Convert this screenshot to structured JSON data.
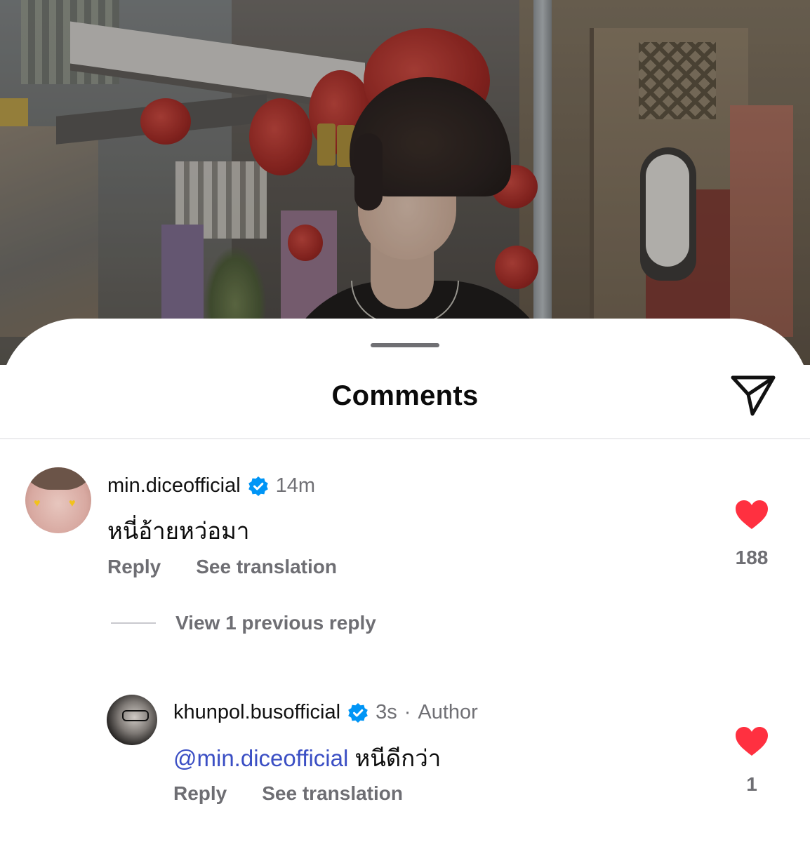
{
  "sheet": {
    "title": "Comments"
  },
  "comments": [
    {
      "username": "min.diceofficial",
      "time": "14m",
      "text": "หนี่อ้ายหว่อมา",
      "reply_label": "Reply",
      "translate_label": "See translation",
      "likes": "188"
    }
  ],
  "view_replies": "View 1 previous reply",
  "replies": [
    {
      "username": "khunpol.busofficial",
      "time": "3s",
      "author_sep": "·",
      "author_badge": "Author",
      "mention": "@min.diceofficial",
      "text": "หนีดีกว่า",
      "reply_label": "Reply",
      "translate_label": "See translation",
      "likes": "1"
    }
  ],
  "colors": {
    "heart": "#ff3040",
    "verified": "#0095f6",
    "mention": "#3b4fc4",
    "secondary_text": "#6e6e73"
  },
  "icons": {
    "send": "paper-plane",
    "like": "heart-filled",
    "verified": "verified-badge"
  }
}
